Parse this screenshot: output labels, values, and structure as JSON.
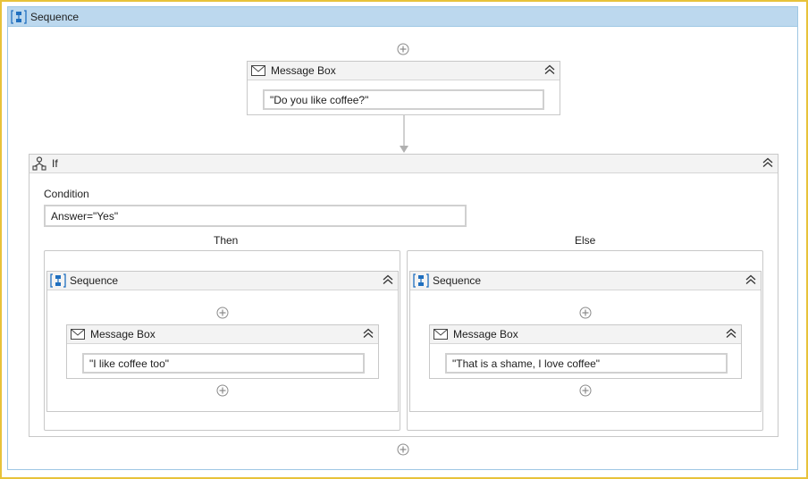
{
  "colors": {
    "window_border": "#e8c23a",
    "sequence_header": "#bcd8ee",
    "sequence_border": "#9ec7e4",
    "activity_header": "#f3f3f3",
    "activity_border": "#c8c8c8",
    "icon_blue": "#1f6fbf"
  },
  "outer_sequence": {
    "title": "Sequence",
    "icon": "sequence-icon"
  },
  "message_box_1": {
    "title": "Message Box",
    "icon": "envelope-icon",
    "text_value": "\"Do you like coffee?\""
  },
  "if_activity": {
    "title": "If",
    "icon": "if-icon",
    "condition_label": "Condition",
    "condition_value": "Answer=\"Yes\"",
    "then_label": "Then",
    "else_label": "Else"
  },
  "then_sequence": {
    "title": "Sequence",
    "message_box": {
      "title": "Message Box",
      "text_value": "\"I like coffee too\""
    }
  },
  "else_sequence": {
    "title": "Sequence",
    "message_box": {
      "title": "Message Box",
      "text_value": "\"That is a shame, I love coffee\""
    }
  }
}
